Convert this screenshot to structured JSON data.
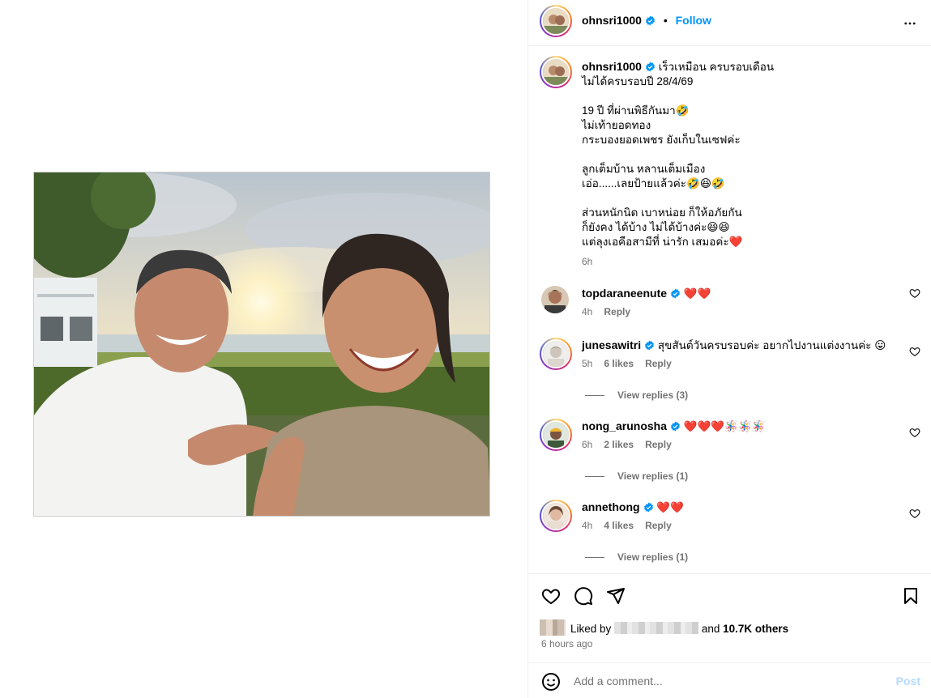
{
  "post": {
    "username": "ohnsri1000",
    "follow_label": "Follow",
    "separator": "•",
    "caption_lines": [
      "เร็วเหมือน ครบรอบเดือน",
      "ไม่ได้ครบรอบปี 28/4/69",
      "",
      "19 ปี ที่ผ่านพิธีกันมา🤣",
      "ไม่เท้ายอดทอง",
      "กระบองยอดเพชร ยังเก็บในเซฟค่ะ",
      "",
      "ลูกเต็มบ้าน หลานเต็มเมือง",
      "เอ่อ......เลยป้ายแล้วค่ะ🤣😆🤣",
      "",
      "ส่วนหนักนิด เบาหน่อย ก็ให้อภัยกัน",
      "ก็ยังคง ได้บ้าง ไม่ได้บ้างค่ะ😆😆",
      "แต่ลุงเอคือสามีที่ น่ารัก เสมอค่ะ❤️"
    ],
    "caption_time": "6h",
    "more_icon": "more-horizontal-icon"
  },
  "comments": [
    {
      "username": "topdaraneenute",
      "text": "❤️❤️",
      "time": "4h",
      "likes": "",
      "reply": "Reply",
      "replies": ""
    },
    {
      "username": "junesawitri",
      "text": "สุขสันต์วันครบรอบค่ะ อยากไปงานแต่งงานค่ะ 😛",
      "time": "5h",
      "likes": "6 likes",
      "reply": "Reply",
      "replies": "View replies (3)"
    },
    {
      "username": "nong_arunosha",
      "text": "❤️❤️❤️🪅🪅🪅",
      "time": "6h",
      "likes": "2 likes",
      "reply": "Reply",
      "replies": "View replies (1)"
    },
    {
      "username": "annethong",
      "text": "❤️❤️",
      "time": "4h",
      "likes": "4 likes",
      "reply": "Reply",
      "replies": "View replies (1)"
    }
  ],
  "actions": {
    "liked_prefix": "Liked by",
    "liked_suffix_and": "and",
    "liked_others": "10.7K others",
    "time_ago": "6 hours ago"
  },
  "composer": {
    "placeholder": "Add a comment...",
    "post_label": "Post"
  },
  "colors": {
    "link_blue": "#0095f6",
    "muted": "#737373",
    "heart_red": "#e0102f"
  }
}
